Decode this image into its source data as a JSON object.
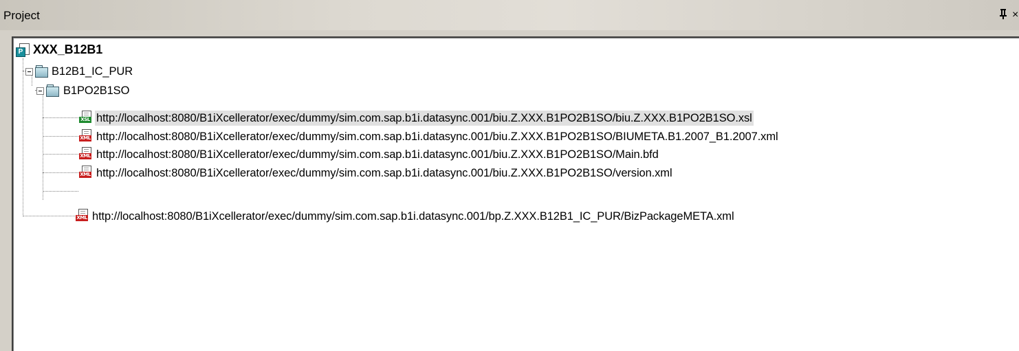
{
  "panel": {
    "title": "Project",
    "pin_glyph": "pin-icon",
    "close_glyph": "close-icon"
  },
  "tree": {
    "root": {
      "label": "XXX_B12B1",
      "icon": "project-icon"
    },
    "folders": [
      {
        "label": "B12B1_IC_PUR",
        "icon": "folder-icon"
      },
      {
        "label": "B1PO2B1SO",
        "icon": "folder-icon"
      }
    ],
    "files": [
      {
        "label": "http://localhost:8080/B1iXcellerator/exec/dummy/sim.com.sap.b1i.datasync.001/biu.Z.XXX.B1PO2B1SO/biu.Z.XXX.B1PO2B1SO.xsl",
        "badge": "XSL",
        "selected": true
      },
      {
        "label": "http://localhost:8080/B1iXcellerator/exec/dummy/sim.com.sap.b1i.datasync.001/biu.Z.XXX.B1PO2B1SO/BIUMETA.B1.2007_B1.2007.xml",
        "badge": "XML"
      },
      {
        "label": "http://localhost:8080/B1iXcellerator/exec/dummy/sim.com.sap.b1i.datasync.001/biu.Z.XXX.B1PO2B1SO/Main.bfd",
        "badge": "XML"
      },
      {
        "label": "http://localhost:8080/B1iXcellerator/exec/dummy/sim.com.sap.b1i.datasync.001/biu.Z.XXX.B1PO2B1SO/version.xml",
        "badge": "XML"
      },
      {
        "label": "http://localhost:8080/B1iXcellerator/exec/dummy/sim.com.sap.b1i.datasync.001/bp.Z.XXX.B12B1_IC_PUR/BizPackageMETA.xml",
        "badge": "XML"
      }
    ]
  }
}
